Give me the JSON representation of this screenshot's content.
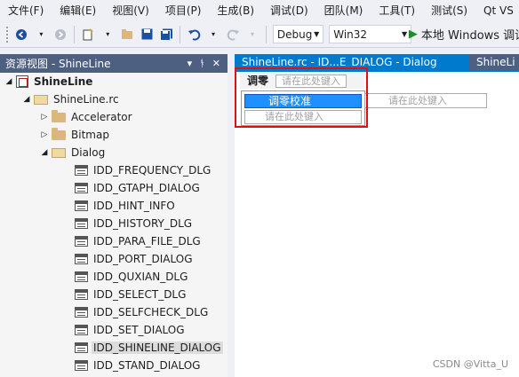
{
  "menubar": {
    "items": [
      "文件(F)",
      "编辑(E)",
      "视图(V)",
      "项目(P)",
      "生成(B)",
      "调试(D)",
      "团队(M)",
      "工具(T)",
      "测试(S)",
      "Qt VS"
    ]
  },
  "toolbar": {
    "config_value": "Debug",
    "platform_value": "Win32",
    "run_label": "本地 Windows 调试"
  },
  "panel": {
    "title": "资源视图 - ShineLine",
    "pin_glyph": "▾ ㅍ ✕"
  },
  "tree": {
    "project": "ShineLine",
    "rc_file": "ShineLine.rc",
    "folders": [
      "Accelerator",
      "Bitmap",
      "Dialog"
    ],
    "dialogs": [
      "IDD_FREQUENCY_DLG",
      "IDD_GTAPH_DIALOG",
      "IDD_HINT_INFO",
      "IDD_HISTORY_DLG",
      "IDD_PARA_FILE_DLG",
      "IDD_PORT_DIALOG",
      "IDD_QUXIAN_DLG",
      "IDD_SELECT_DLG",
      "IDD_SELFCHECK_DLG",
      "IDD_SET_DIALOG",
      "IDD_SHINELINE_DIALOG",
      "IDD_STAND_DIALOG"
    ]
  },
  "doc_tabs": {
    "active": "ShineLine.rc - ID...E_DIALOG - Dialog",
    "inactive": "ShineLi"
  },
  "menu_editor": {
    "top_item": "调零",
    "type_here": "请在此处键入",
    "popup_selected": "调零校准",
    "popup_type_here": "请在此处键入",
    "submenu_type_here": "请在此处键入"
  },
  "watermark": "CSDN @Vitta_U"
}
